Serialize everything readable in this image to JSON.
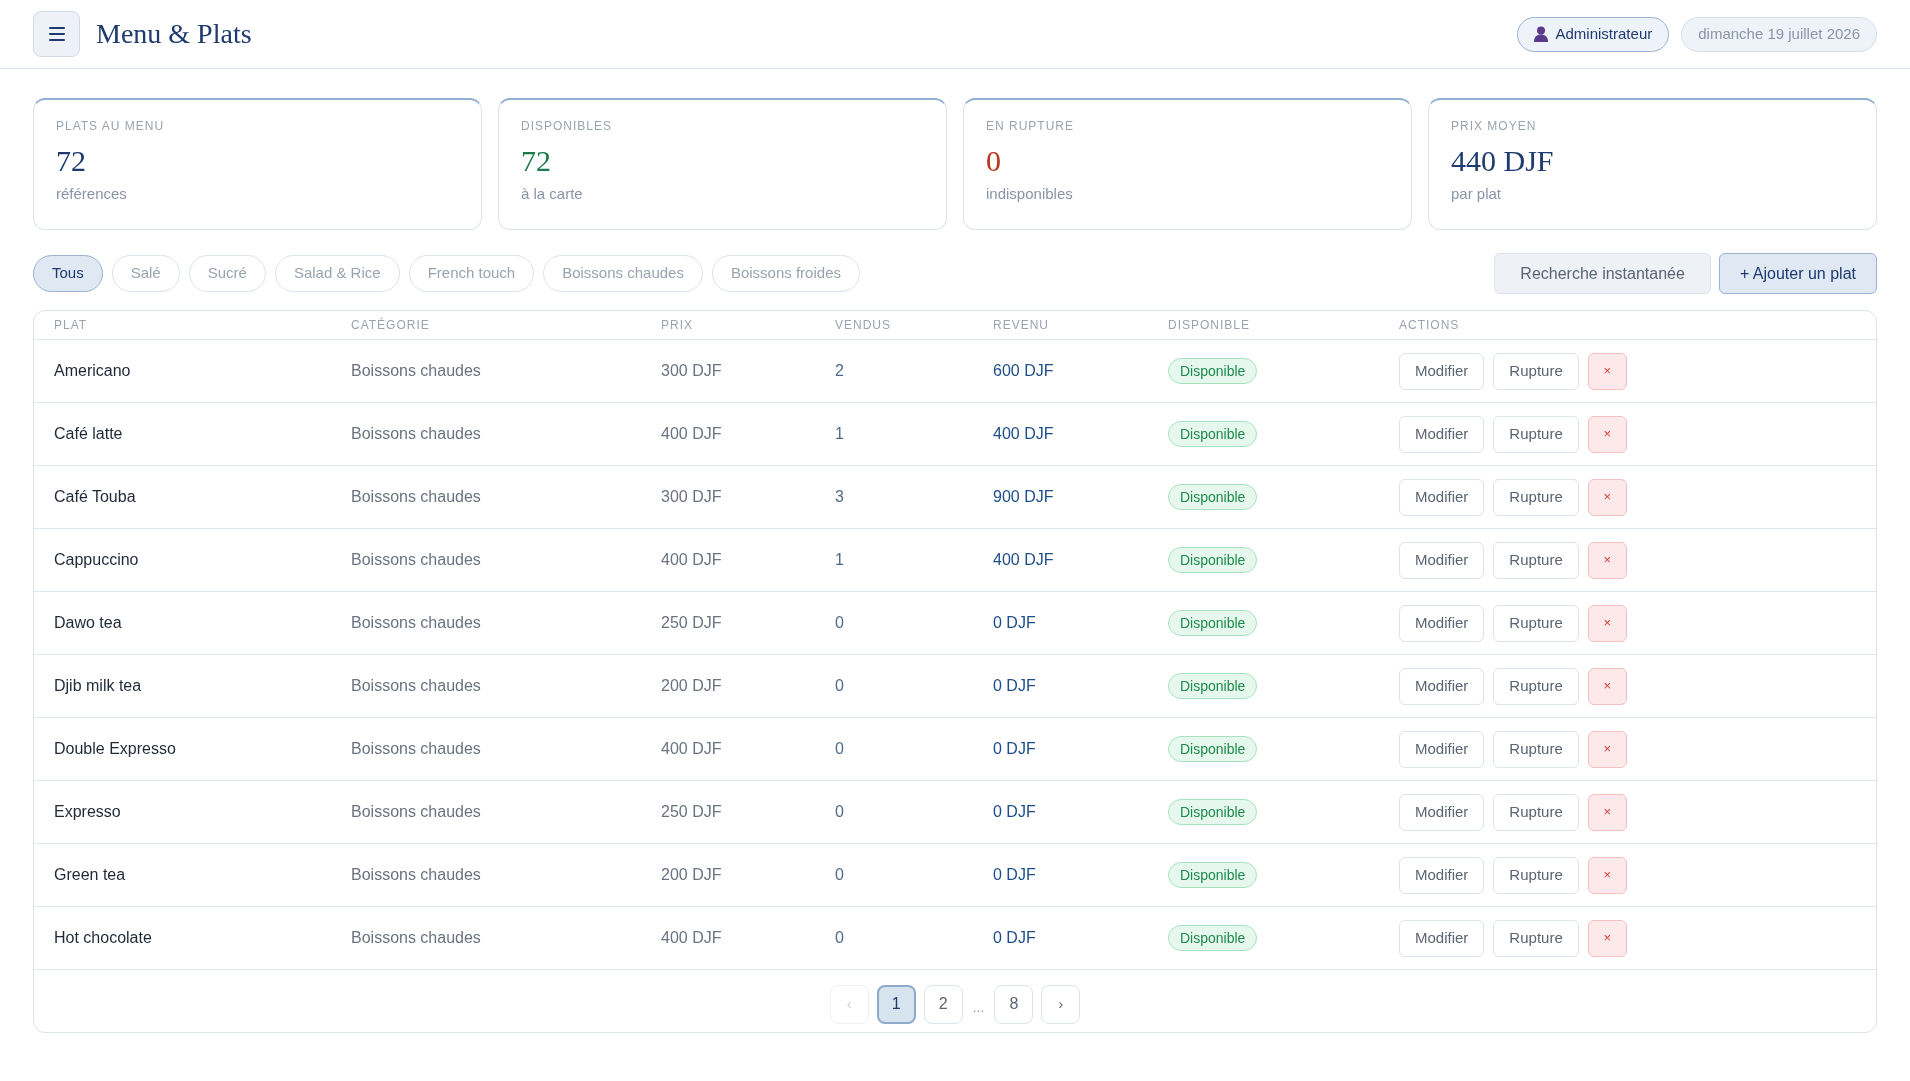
{
  "header": {
    "title": "Menu & Plats",
    "user": "Administrateur",
    "date": "dimanche 19 juillet 2026"
  },
  "stats": [
    {
      "label": "PLATS AU MENU",
      "value": "72",
      "caption": "références",
      "color": "#1e3a6e"
    },
    {
      "label": "DISPONIBLES",
      "value": "72",
      "caption": "à la carte",
      "color": "#1a7a4c"
    },
    {
      "label": "EN RUPTURE",
      "value": "0",
      "caption": "indisponibles",
      "color": "#b8321c"
    },
    {
      "label": "PRIX MOYEN",
      "value": "440 DJF",
      "caption": "par plat",
      "color": "#1e3a6e"
    }
  ],
  "filters": [
    {
      "label": "Tous",
      "selected": true
    },
    {
      "label": "Salé",
      "selected": false
    },
    {
      "label": "Sucré",
      "selected": false
    },
    {
      "label": "Salad & Rice",
      "selected": false
    },
    {
      "label": "French touch",
      "selected": false
    },
    {
      "label": "Boissons chaudes",
      "selected": false
    },
    {
      "label": "Boissons froides",
      "selected": false
    }
  ],
  "toolbar_buttons": [
    {
      "kind": "secondary",
      "label": "Recherche instantanée"
    },
    {
      "kind": "primary",
      "label": "+ Ajouter un plat"
    }
  ],
  "table": {
    "columns": [
      "PLAT",
      "CATÉGORIE",
      "PRIX",
      "VENDUS",
      "REVENU",
      "DISPONIBLE",
      "ACTIONS"
    ],
    "rows": [
      {
        "name": "Americano",
        "category": "Boissons chaudes",
        "price": "300 DJF",
        "sold": "2",
        "revenue": "600 DJF",
        "status": {
          "label": "Disponible",
          "available": true
        },
        "actions": [
          {
            "kind": "edit",
            "label": "Modifier"
          },
          {
            "kind": "stock",
            "label": "Rupture"
          },
          {
            "kind": "delete",
            "label": "×"
          }
        ]
      },
      {
        "name": "Café latte",
        "category": "Boissons chaudes",
        "price": "400 DJF",
        "sold": "1",
        "revenue": "400 DJF",
        "status": {
          "label": "Disponible",
          "available": true
        },
        "actions": [
          {
            "kind": "edit",
            "label": "Modifier"
          },
          {
            "kind": "stock",
            "label": "Rupture"
          },
          {
            "kind": "delete",
            "label": "×"
          }
        ]
      },
      {
        "name": "Café Touba",
        "category": "Boissons chaudes",
        "price": "300 DJF",
        "sold": "3",
        "revenue": "900 DJF",
        "status": {
          "label": "Disponible",
          "available": true
        },
        "actions": [
          {
            "kind": "edit",
            "label": "Modifier"
          },
          {
            "kind": "stock",
            "label": "Rupture"
          },
          {
            "kind": "delete",
            "label": "×"
          }
        ]
      },
      {
        "name": "Cappuccino",
        "category": "Boissons chaudes",
        "price": "400 DJF",
        "sold": "1",
        "revenue": "400 DJF",
        "status": {
          "label": "Disponible",
          "available": true
        },
        "actions": [
          {
            "kind": "edit",
            "label": "Modifier"
          },
          {
            "kind": "stock",
            "label": "Rupture"
          },
          {
            "kind": "delete",
            "label": "×"
          }
        ]
      },
      {
        "name": "Dawo tea",
        "category": "Boissons chaudes",
        "price": "250 DJF",
        "sold": "0",
        "revenue": "0 DJF",
        "status": {
          "label": "Disponible",
          "available": true
        },
        "actions": [
          {
            "kind": "edit",
            "label": "Modifier"
          },
          {
            "kind": "stock",
            "label": "Rupture"
          },
          {
            "kind": "delete",
            "label": "×"
          }
        ]
      },
      {
        "name": "Djib milk tea",
        "category": "Boissons chaudes",
        "price": "200 DJF",
        "sold": "0",
        "revenue": "0 DJF",
        "status": {
          "label": "Disponible",
          "available": true
        },
        "actions": [
          {
            "kind": "edit",
            "label": "Modifier"
          },
          {
            "kind": "stock",
            "label": "Rupture"
          },
          {
            "kind": "delete",
            "label": "×"
          }
        ]
      },
      {
        "name": "Double Expresso",
        "category": "Boissons chaudes",
        "price": "400 DJF",
        "sold": "0",
        "revenue": "0 DJF",
        "status": {
          "label": "Disponible",
          "available": true
        },
        "actions": [
          {
            "kind": "edit",
            "label": "Modifier"
          },
          {
            "kind": "stock",
            "label": "Rupture"
          },
          {
            "kind": "delete",
            "label": "×"
          }
        ]
      },
      {
        "name": "Expresso",
        "category": "Boissons chaudes",
        "price": "250 DJF",
        "sold": "0",
        "revenue": "0 DJF",
        "status": {
          "label": "Disponible",
          "available": true
        },
        "actions": [
          {
            "kind": "edit",
            "label": "Modifier"
          },
          {
            "kind": "stock",
            "label": "Rupture"
          },
          {
            "kind": "delete",
            "label": "×"
          }
        ]
      },
      {
        "name": "Green tea",
        "category": "Boissons chaudes",
        "price": "200 DJF",
        "sold": "0",
        "revenue": "0 DJF",
        "status": {
          "label": "Disponible",
          "available": true
        },
        "actions": [
          {
            "kind": "edit",
            "label": "Modifier"
          },
          {
            "kind": "stock",
            "label": "Rupture"
          },
          {
            "kind": "delete",
            "label": "×"
          }
        ]
      },
      {
        "name": "Hot chocolate",
        "category": "Boissons chaudes",
        "price": "400 DJF",
        "sold": "0",
        "revenue": "0 DJF",
        "status": {
          "label": "Disponible",
          "available": true
        },
        "actions": [
          {
            "kind": "edit",
            "label": "Modifier"
          },
          {
            "kind": "stock",
            "label": "Rupture"
          },
          {
            "kind": "delete",
            "label": "×"
          }
        ]
      }
    ]
  },
  "pagination": {
    "prev": {
      "label": "‹",
      "disabled": true
    },
    "pages": [
      {
        "kind": "page",
        "label": "1",
        "selected": true
      },
      {
        "kind": "page",
        "label": "2",
        "selected": false
      },
      {
        "kind": "ellipsis",
        "label": "..."
      },
      {
        "kind": "page",
        "label": "8",
        "selected": false
      }
    ],
    "next": {
      "label": "›",
      "disabled": false
    }
  }
}
